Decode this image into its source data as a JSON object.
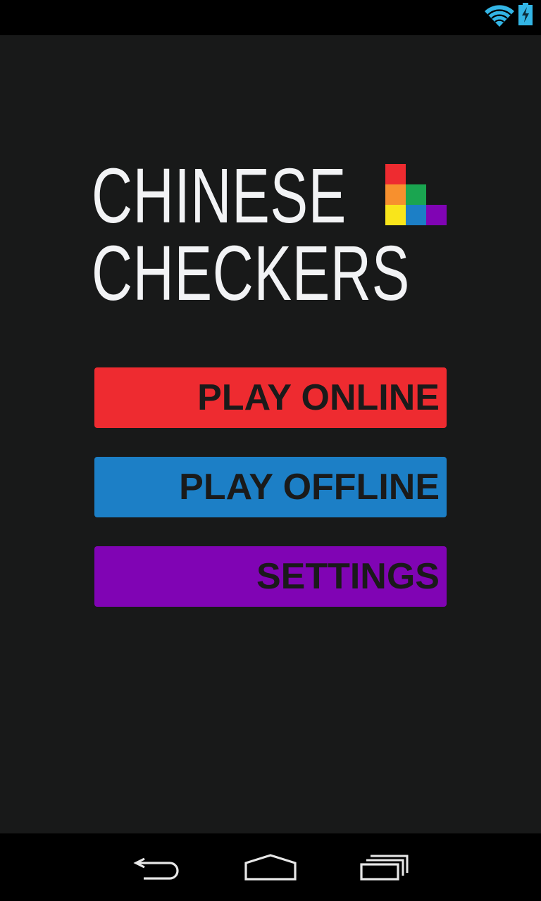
{
  "status_bar": {
    "wifi_icon": "wifi-icon",
    "battery_icon": "battery-charging-icon",
    "icon_color": "#33b5e5"
  },
  "title": {
    "line1": "CHINESE",
    "line2": "CHECKERS",
    "logo_colors": [
      "#ee2b30",
      "#f7902e",
      "#1aa550",
      "#f9e51b",
      "#1c7fc6",
      "#8004b4"
    ]
  },
  "menu": {
    "play_online": "PLAY ONLINE",
    "play_offline": "PLAY OFFLINE",
    "settings": "SETTINGS",
    "colors": {
      "play_online": "#ee2b30",
      "play_offline": "#1c7fc6",
      "settings": "#8004b4"
    }
  },
  "nav_bar": {
    "back_icon": "back-icon",
    "home_icon": "home-icon",
    "recents_icon": "recents-icon"
  }
}
